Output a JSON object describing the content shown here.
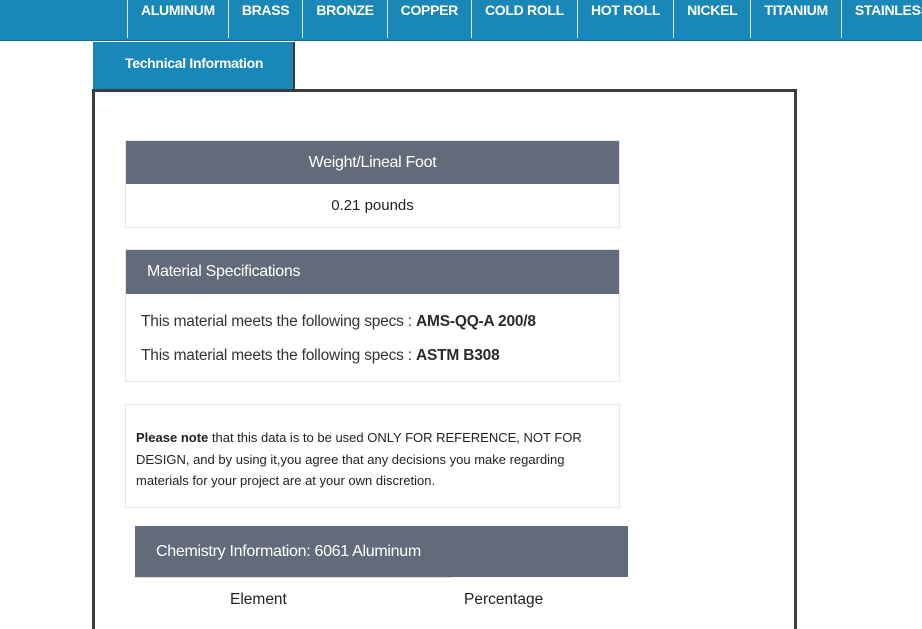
{
  "nav": {
    "items": [
      "ALUMINUM",
      "BRASS",
      "BRONZE",
      "COPPER",
      "COLD ROLL",
      "HOT ROLL",
      "NICKEL",
      "TITANIUM",
      "STAINLESS"
    ]
  },
  "tab": {
    "label": "Technical Information"
  },
  "weight": {
    "header": "Weight/Lineal Foot",
    "value": "0.21 pounds"
  },
  "specs": {
    "header": "Material Specifications",
    "lines": [
      {
        "prefix": "This material meets the following specs : ",
        "spec": "AMS-QQ-A 200/8"
      },
      {
        "prefix": "This material meets the following specs : ",
        "spec": "ASTM B308"
      }
    ]
  },
  "note": {
    "bold": "Please note",
    "text": " that this data is to be used ONLY FOR REFERENCE, NOT FOR DESIGN, and by using it,you agree that any decisions you make regarding materials for your project are at your own discretion."
  },
  "chemistry": {
    "header": "Chemistry Information: 6061 Aluminum",
    "columns": [
      "Element",
      "Percentage"
    ]
  },
  "colors": {
    "brand_blue": "#1a87b9",
    "header_gray": "#636b7a"
  }
}
